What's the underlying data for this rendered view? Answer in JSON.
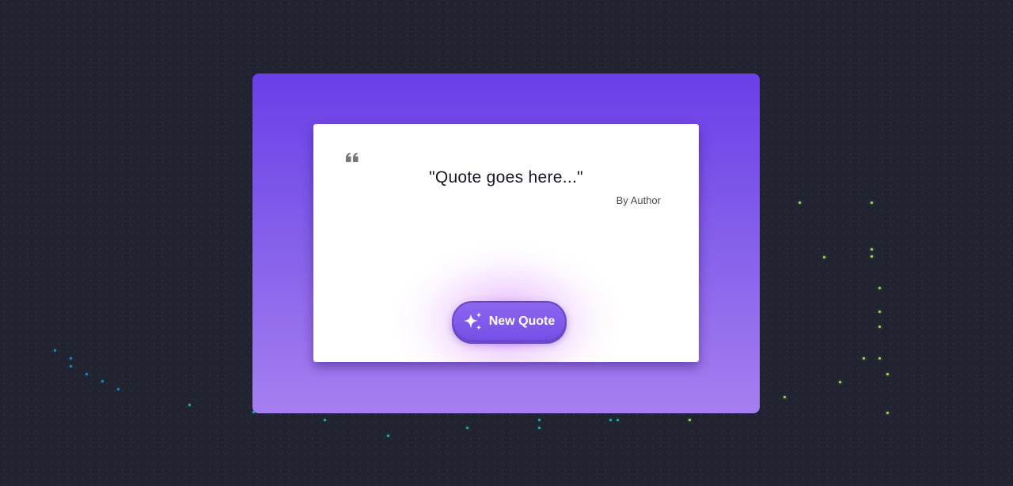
{
  "quote": {
    "text": "\"Quote goes here...\"",
    "author": "By Author",
    "icon": "quote-left-icon"
  },
  "button": {
    "label": "New Quote",
    "icon": "sparkles-icon"
  },
  "colors": {
    "background": "#212331",
    "card_gradient_top": "#6a3fe8",
    "card_gradient_bottom": "#a57ff0",
    "button": "#7f5aee",
    "particle_green": "#9be35a",
    "particle_teal": "#1fb8a8"
  }
}
